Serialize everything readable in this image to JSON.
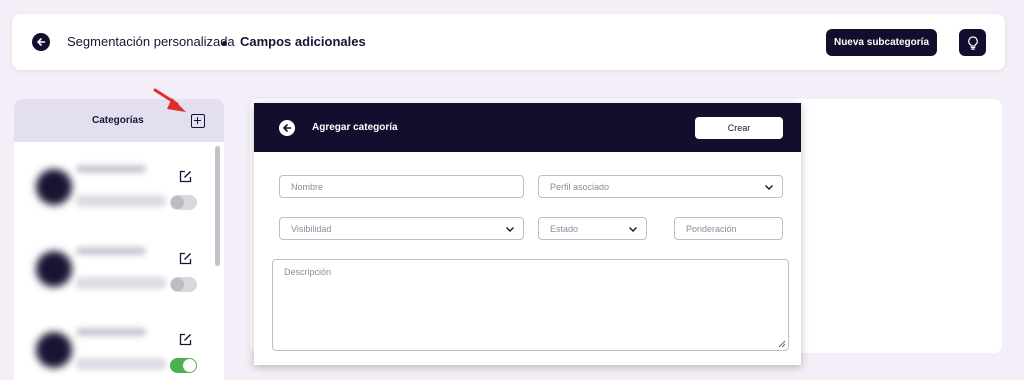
{
  "header": {
    "breadcrumb_1": "Segmentación personalizada",
    "breadcrumb_2": "Campos adicionales",
    "new_subcategory_label": "Nueva subcategoría"
  },
  "sidebar": {
    "title": "Categorías",
    "items": [
      {
        "toggle_on": false
      },
      {
        "toggle_on": false
      },
      {
        "toggle_on": true
      }
    ]
  },
  "modal": {
    "title": "Agregar categoría",
    "create_label": "Crear",
    "fields": {
      "nombre_placeholder": "Nombre",
      "perfil_placeholder": "Perfil asociado",
      "visibilidad_placeholder": "Visibilidad",
      "estado_placeholder": "Estado",
      "ponderacion_placeholder": "Ponderación",
      "descripcion_placeholder": "Descripción"
    }
  },
  "colors": {
    "dark": "#120f2e",
    "background": "#f3eef7",
    "sidebar_header": "#e3dfef",
    "toggle_on": "#4caf50",
    "annotation_arrow": "#e32b2b"
  },
  "icons": [
    "back-arrow-icon",
    "lightbulb-icon",
    "add-square-icon",
    "edit-icon",
    "chevron-down-icon",
    "resize-handle-icon"
  ]
}
